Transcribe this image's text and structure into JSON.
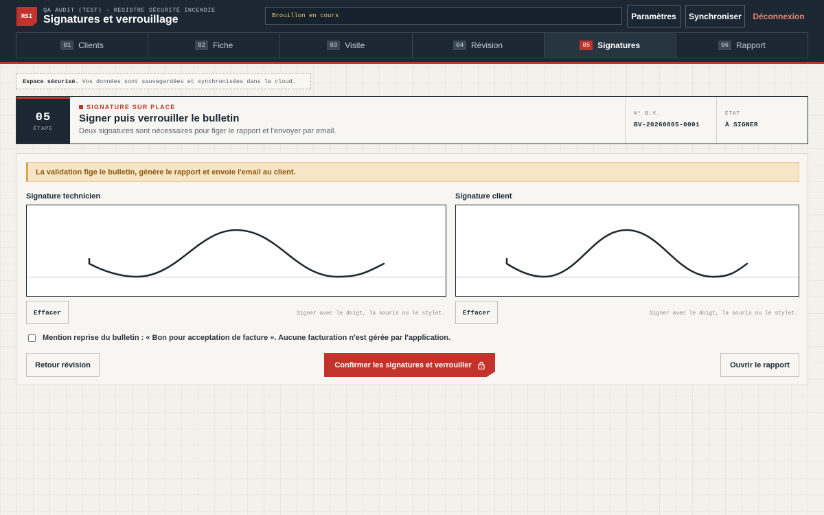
{
  "header": {
    "logo": "RSI",
    "subtitle": "QA AUDIT (TEST) · REGISTRE SÉCURITÉ INCENDIE",
    "title": "Signatures et verrouillage",
    "status": "Brouillon en cours",
    "buttons": {
      "settings": "Paramètres",
      "sync": "Synchroniser",
      "logout": "Déconnexion"
    }
  },
  "tabs": [
    {
      "num": "01",
      "label": "Clients"
    },
    {
      "num": "02",
      "label": "Fiche"
    },
    {
      "num": "03",
      "label": "Visite"
    },
    {
      "num": "04",
      "label": "Révision"
    },
    {
      "num": "05",
      "label": "Signatures",
      "active": true
    },
    {
      "num": "06",
      "label": "Rapport"
    }
  ],
  "secure_note": {
    "strong": "Espace sécurisé.",
    "text": "Vos données sont sauvegardées et synchronisées dans le cloud."
  },
  "step": {
    "number": "05",
    "number_label": "ÉTAPE",
    "kicker": "SIGNATURE SUR PLACE",
    "title": "Signer puis verrouiller le bulletin",
    "description": "Deux signatures sont nécessaires pour figer le rapport et l'envoyer par email.",
    "bv_label": "N° B.V.",
    "bv_value": "BV-20260805-0001",
    "state_label": "ÉTAT",
    "state_value": "À SIGNER"
  },
  "panel": {
    "warning": "La validation fige le bulletin, génère le rapport et envoie l'email au client.",
    "technician": {
      "label": "Signature technicien",
      "clear": "Effacer",
      "hint": "Signer avec le doigt, la souris ou le stylet."
    },
    "client": {
      "label": "Signature client",
      "clear": "Effacer",
      "hint": "Signer avec le doigt, la souris ou le stylet."
    },
    "mention": "Mention reprise du bulletin : « Bon pour acceptation de facture ». Aucune facturation n'est gérée par l'application.",
    "mention_checked": false,
    "back_button": "Retour révision",
    "confirm_button": "Confirmer les signatures et verrouiller",
    "open_button": "Ouvrir le rapport"
  },
  "colors": {
    "header_bg": "#1b2834",
    "accent": "#c4332b",
    "warning_bg": "#f6e6c6",
    "warning_text": "#8b5a12",
    "status_text": "#f0c869",
    "logout_text": "#e8836e"
  },
  "icons": [
    "lock-icon"
  ]
}
